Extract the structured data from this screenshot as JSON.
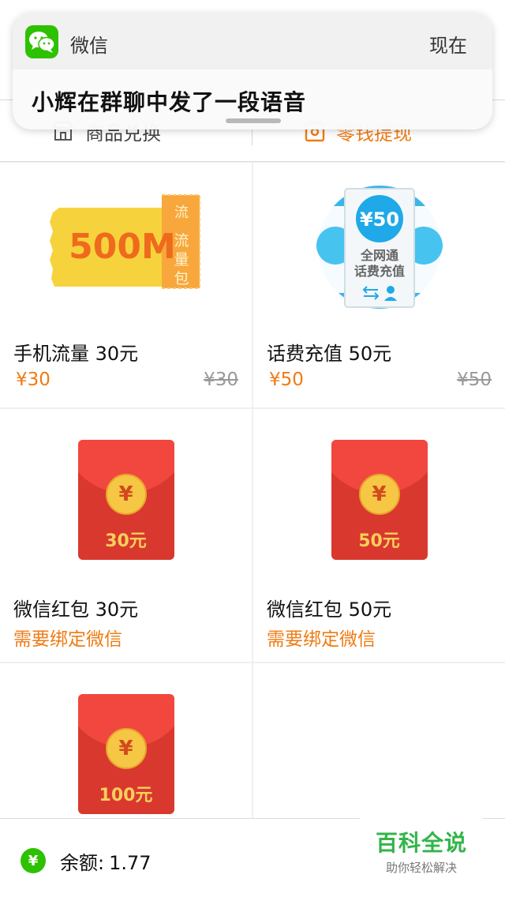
{
  "notification": {
    "app_name": "微信",
    "time": "现在",
    "message": "小辉在群聊中发了一段语音"
  },
  "tabs": {
    "left_label": "商品兑换",
    "right_label": "零钱提现",
    "active": "right",
    "accent_color": "#ef7b13"
  },
  "products": [
    {
      "title": "手机流量 30元",
      "price": "¥30",
      "old_price": "¥30",
      "image": {
        "kind": "data-ticket",
        "big": "500M",
        "side": "流量包",
        "corner": "流"
      }
    },
    {
      "title": "话费充值 50元",
      "price": "¥50",
      "old_price": "¥50",
      "image": {
        "kind": "phone-credit",
        "coin": "¥50",
        "line1": "全网通",
        "line2": "话费充值"
      }
    },
    {
      "title": "微信红包 30元",
      "note": "需要绑定微信",
      "image": {
        "kind": "red-envelope",
        "coin": "¥",
        "amount": "30元"
      }
    },
    {
      "title": "微信红包 50元",
      "note": "需要绑定微信",
      "image": {
        "kind": "red-envelope",
        "coin": "¥",
        "amount": "50元"
      }
    },
    {
      "image": {
        "kind": "red-envelope",
        "coin": "¥",
        "amount": "100元"
      }
    }
  ],
  "footer": {
    "icon": "yen-icon",
    "badge": "¥",
    "balance_label": "余额:",
    "balance_value": "1.77"
  },
  "watermark": {
    "title": "百科全说",
    "subtitle": "助你轻松解决"
  }
}
